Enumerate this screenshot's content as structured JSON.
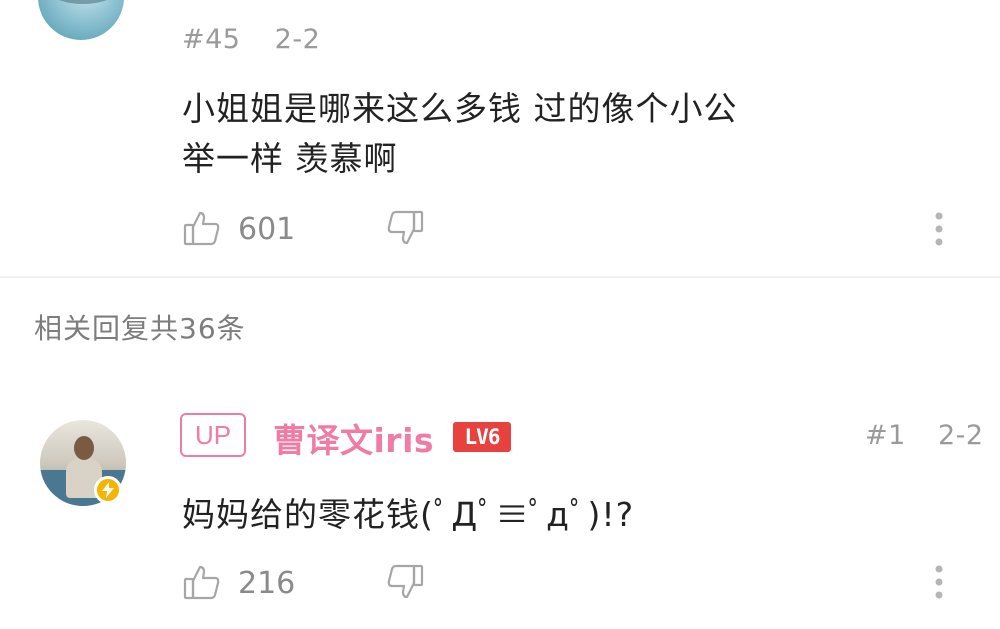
{
  "comments": [
    {
      "floor": "#45",
      "date": "2-2",
      "text_lines": [
        "小姐姐是哪来这么多钱 过的像个小公",
        "举一样 羡慕啊"
      ],
      "likes": "601"
    },
    {
      "badge": "UP",
      "username": "曹译文iris",
      "level": "LV6",
      "floor": "#1",
      "date": "2-2",
      "text": "妈妈给的零花钱(ﾟДﾟ≡ﾟдﾟ)!?",
      "likes": "216"
    }
  ],
  "replies_header": "相关回复共36条",
  "icons": [
    "thumbs-up-icon",
    "thumbs-down-icon",
    "more-vertical-icon",
    "lightning-icon"
  ],
  "colors": {
    "accent": "#f07ca3",
    "level": "#e7423e",
    "verified": "#f4b400",
    "muted": "#9a9a9a"
  }
}
